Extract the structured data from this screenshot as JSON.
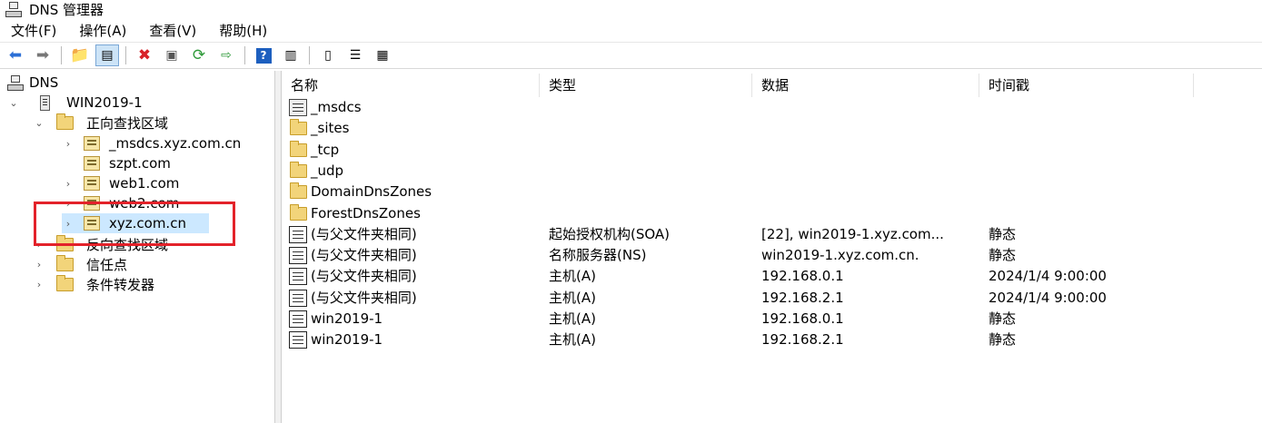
{
  "window": {
    "title": "DNS 管理器"
  },
  "menu": [
    "文件(F)",
    "操作(A)",
    "查看(V)",
    "帮助(H)"
  ],
  "toolbar": {
    "icons": [
      "back-icon",
      "forward-icon",
      "up-folder-icon",
      "show-hide-console-tree-icon",
      "delete-icon",
      "properties-icon",
      "refresh-icon",
      "export-list-icon",
      "help-icon",
      "action-pane-icon",
      "server-icon",
      "list-icon",
      "detail-icon"
    ]
  },
  "tree": {
    "root": "DNS",
    "server": "WIN2019-1",
    "forward_zones": "正向查找区域",
    "zones": [
      "_msdcs.xyz.com.cn",
      "szpt.com",
      "web1.com",
      "web2.com",
      "xyz.com.cn"
    ],
    "reverse_zones": "反向查找区域",
    "trust_points": "信任点",
    "conditional_forwarders": "条件转发器"
  },
  "list": {
    "columns": [
      "名称",
      "类型",
      "数据",
      "时间戳"
    ],
    "rows": [
      {
        "icon": "subzone",
        "name": "_msdcs",
        "type": "",
        "data": "",
        "timestamp": ""
      },
      {
        "icon": "folder",
        "name": "_sites",
        "type": "",
        "data": "",
        "timestamp": ""
      },
      {
        "icon": "folder",
        "name": "_tcp",
        "type": "",
        "data": "",
        "timestamp": ""
      },
      {
        "icon": "folder",
        "name": "_udp",
        "type": "",
        "data": "",
        "timestamp": ""
      },
      {
        "icon": "folder",
        "name": "DomainDnsZones",
        "type": "",
        "data": "",
        "timestamp": ""
      },
      {
        "icon": "folder",
        "name": "ForestDnsZones",
        "type": "",
        "data": "",
        "timestamp": ""
      },
      {
        "icon": "record",
        "name": "(与父文件夹相同)",
        "type": "起始授权机构(SOA)",
        "data": "[22], win2019-1.xyz.com...",
        "timestamp": "静态"
      },
      {
        "icon": "record",
        "name": "(与父文件夹相同)",
        "type": "名称服务器(NS)",
        "data": "win2019-1.xyz.com.cn.",
        "timestamp": "静态"
      },
      {
        "icon": "record",
        "name": "(与父文件夹相同)",
        "type": "主机(A)",
        "data": "192.168.0.1",
        "timestamp": "2024/1/4 9:00:00"
      },
      {
        "icon": "record",
        "name": "(与父文件夹相同)",
        "type": "主机(A)",
        "data": "192.168.2.1",
        "timestamp": "2024/1/4 9:00:00"
      },
      {
        "icon": "record",
        "name": "win2019-1",
        "type": "主机(A)",
        "data": "192.168.0.1",
        "timestamp": "静态"
      },
      {
        "icon": "record",
        "name": "win2019-1",
        "type": "主机(A)",
        "data": "192.168.2.1",
        "timestamp": "静态"
      }
    ]
  }
}
